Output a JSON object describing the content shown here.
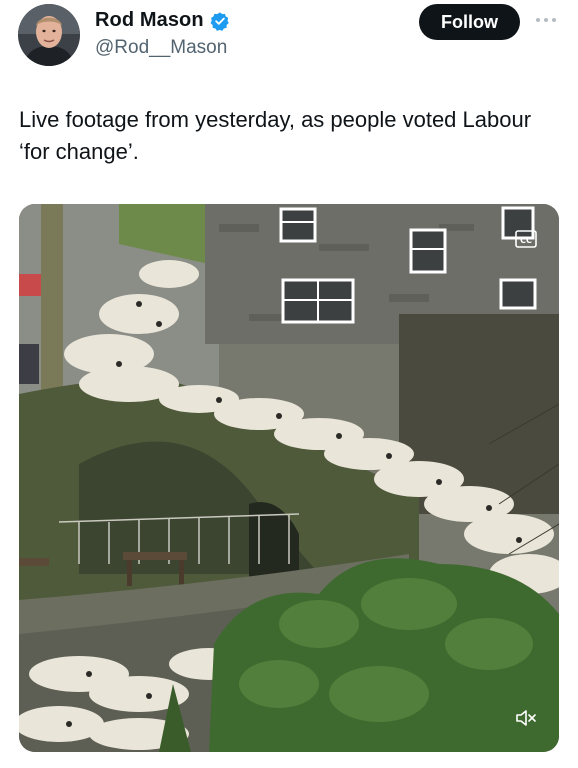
{
  "author": {
    "name": "Rod Mason",
    "handle": "@Rod__Mason",
    "verified": true,
    "verified_color": "#1d9bf0"
  },
  "actions": {
    "follow_label": "Follow",
    "more_icon": "more-horizontal-icon"
  },
  "post": {
    "text": "Live footage from yesterday, as people voted Labour ‘for change’."
  },
  "media": {
    "type": "video",
    "captions_icon": "closed-captions-icon",
    "mute_icon": "speaker-muted-icon"
  },
  "colors": {
    "text_primary": "#0f1419",
    "text_secondary": "#536471",
    "button_bg": "#0f1419"
  }
}
